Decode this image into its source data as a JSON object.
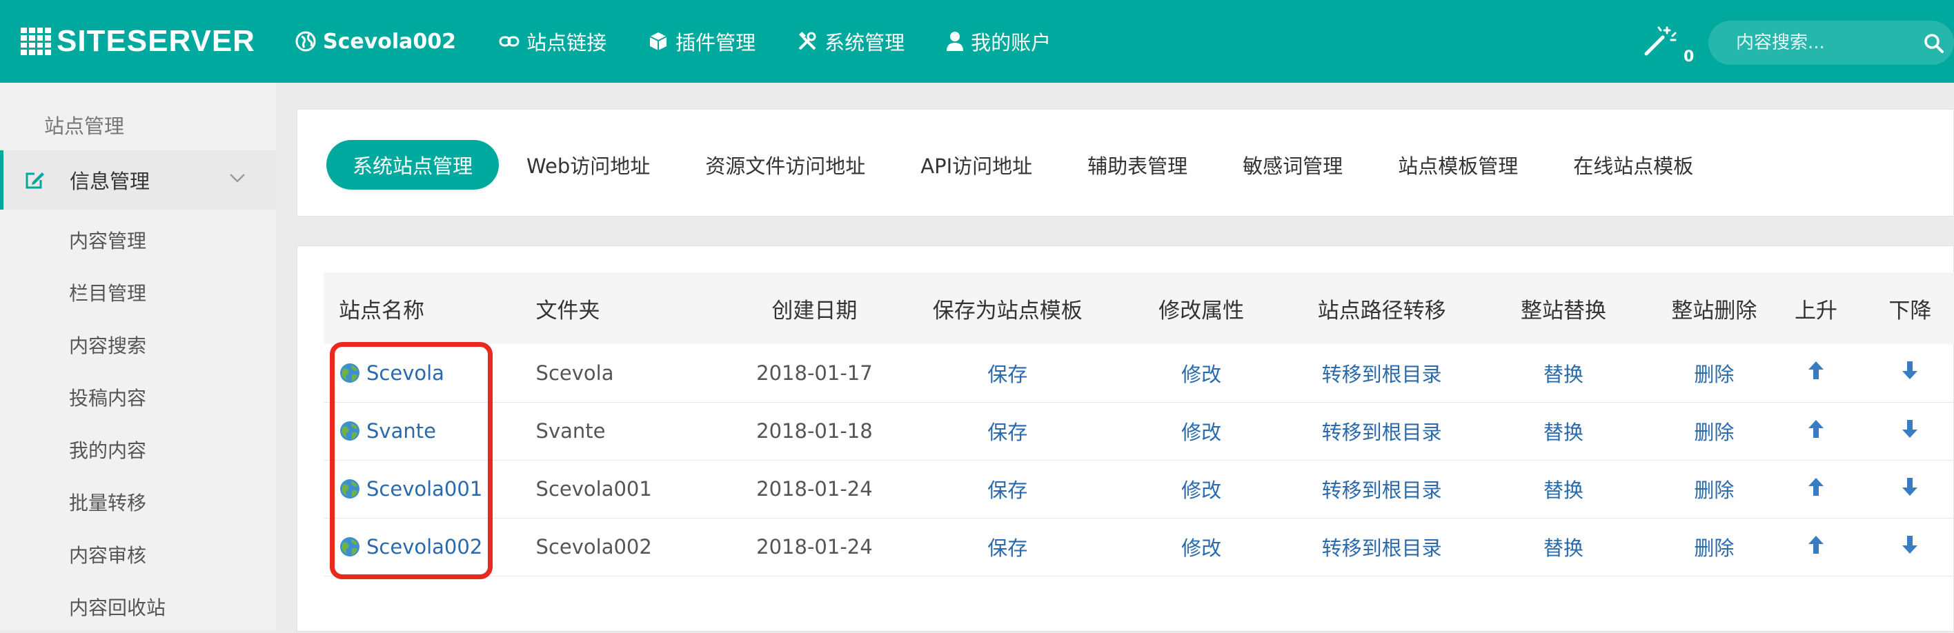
{
  "brand": {
    "logo_text": "SITESERVER"
  },
  "nav": {
    "site_name": "Scevola002",
    "items": [
      {
        "label": "站点链接",
        "icon": "link-icon"
      },
      {
        "label": "插件管理",
        "icon": "cube-icon"
      },
      {
        "label": "系统管理",
        "icon": "tools-icon"
      },
      {
        "label": "我的账户",
        "icon": "user-icon"
      }
    ],
    "notification_count": "0",
    "search_placeholder": "内容搜索..."
  },
  "sidebar": {
    "heading": "站点管理",
    "group_label": "信息管理",
    "items": [
      "内容管理",
      "栏目管理",
      "内容搜索",
      "投稿内容",
      "我的内容",
      "批量转移",
      "内容审核",
      "内容回收站"
    ]
  },
  "tabs": [
    "系统站点管理",
    "Web访问地址",
    "资源文件访问地址",
    "API访问地址",
    "辅助表管理",
    "敏感词管理",
    "站点模板管理",
    "在线站点模板"
  ],
  "table": {
    "headers": [
      "站点名称",
      "文件夹",
      "创建日期",
      "保存为站点模板",
      "修改属性",
      "站点路径转移",
      "整站替换",
      "整站删除",
      "上升",
      "下降"
    ],
    "rows": [
      {
        "name": "Scevola",
        "folder": "Scevola",
        "date": "2018-01-17",
        "save": "保存",
        "edit": "修改",
        "move": "转移到根目录",
        "replace": "替换",
        "delete": "删除"
      },
      {
        "name": "Svante",
        "folder": "Svante",
        "date": "2018-01-18",
        "save": "保存",
        "edit": "修改",
        "move": "转移到根目录",
        "replace": "替换",
        "delete": "删除"
      },
      {
        "name": "Scevola001",
        "folder": "Scevola001",
        "date": "2018-01-24",
        "save": "保存",
        "edit": "修改",
        "move": "转移到根目录",
        "replace": "替换",
        "delete": "删除"
      },
      {
        "name": "Scevola002",
        "folder": "Scevola002",
        "date": "2018-01-24",
        "save": "保存",
        "edit": "修改",
        "move": "转移到根目录",
        "replace": "替换",
        "delete": "删除"
      }
    ]
  },
  "colors": {
    "accent": "#00a99d",
    "link": "#2a6aac",
    "highlight": "#e8291c"
  }
}
